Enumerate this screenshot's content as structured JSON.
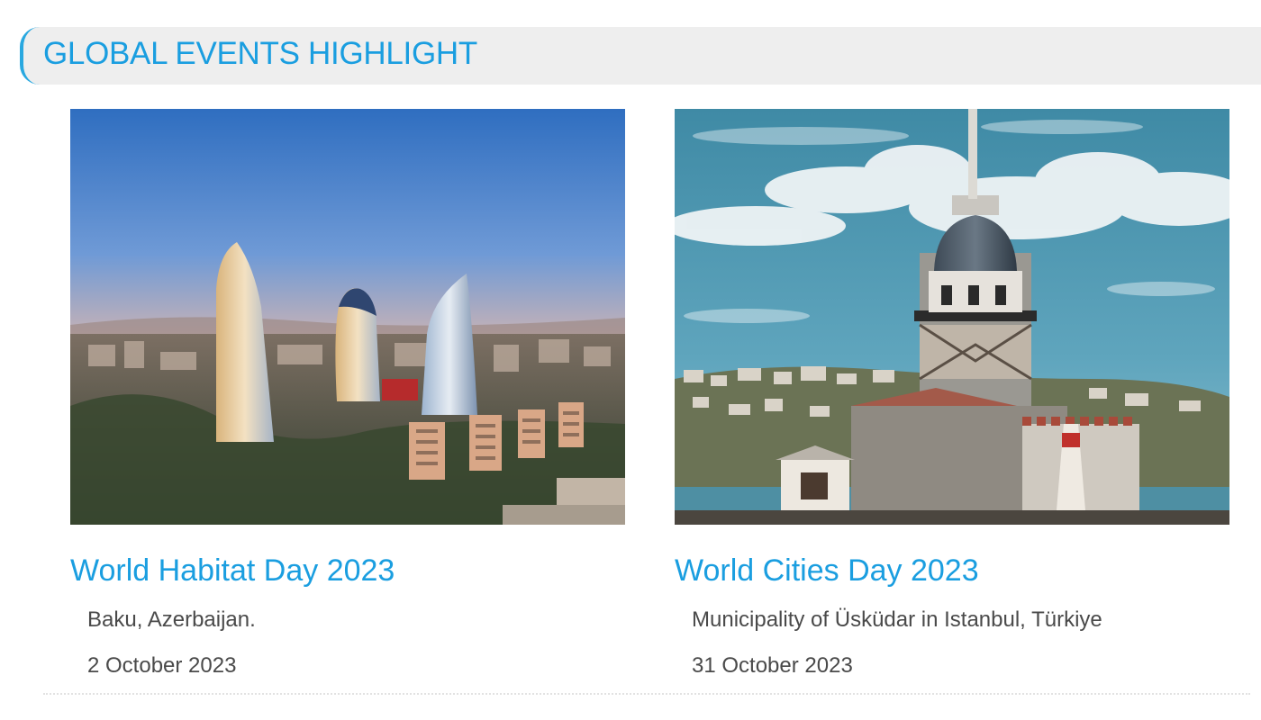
{
  "section": {
    "title": "GLOBAL EVENTS HIGHLIGHT",
    "accent_color": "#1a9ee0"
  },
  "events": [
    {
      "title": "World Habitat Day 2023",
      "location": "Baku, Azerbaijan.",
      "date": "2 October 2023",
      "image": "baku-flame-towers-photo"
    },
    {
      "title": "World Cities Day 2023",
      "location": "Municipality of Üsküdar in Istanbul, Türkiye",
      "date": "31 October 2023",
      "image": "maidens-tower-istanbul-photo"
    }
  ]
}
